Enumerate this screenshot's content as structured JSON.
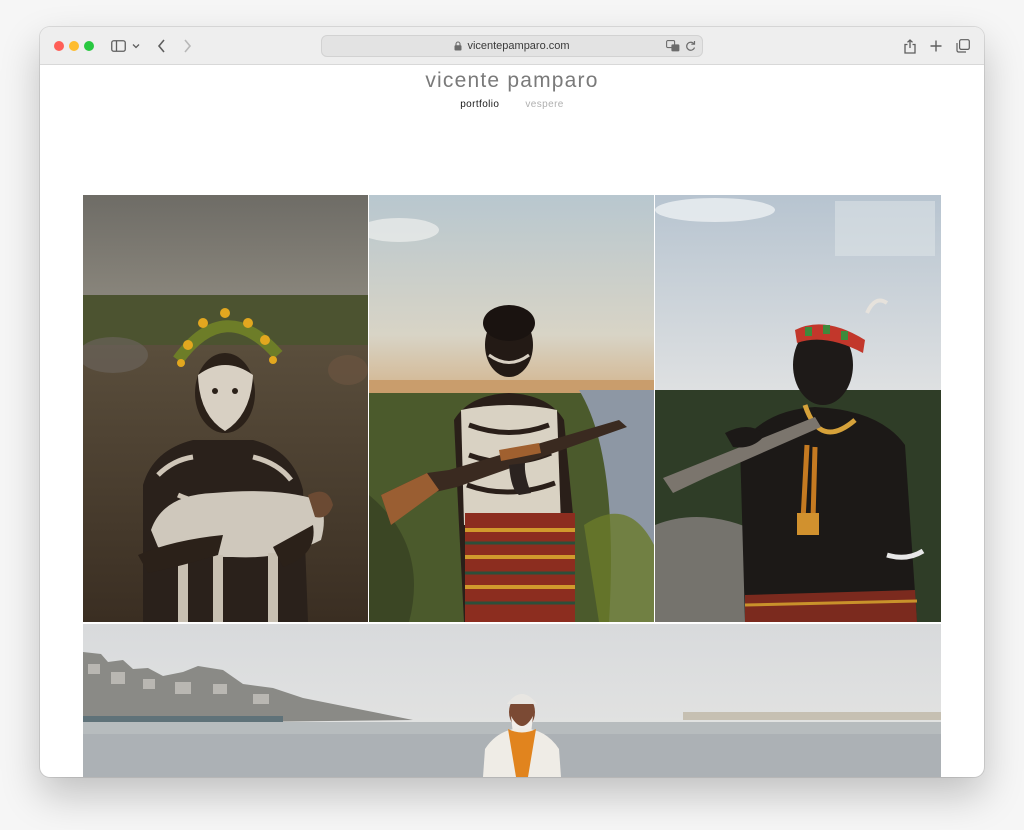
{
  "browser": {
    "url": "vicentepamparo.com"
  },
  "site": {
    "title": "vicente pamparo",
    "nav": [
      {
        "label": "portfolio"
      },
      {
        "label": "vespere"
      }
    ]
  },
  "icons": {
    "sidebar": "sidebar-icon",
    "back": "chevron-left-icon",
    "forward": "chevron-right-icon",
    "lock": "lock-icon",
    "translate": "translate-icon",
    "reload": "reload-icon",
    "share": "share-icon",
    "new_tab": "plus-icon",
    "tabs": "tabs-overview-icon"
  },
  "colors": {
    "title": "#7a7a7a",
    "nav_active": "#1a1a1a",
    "nav_inactive": "#b0b0b0"
  }
}
